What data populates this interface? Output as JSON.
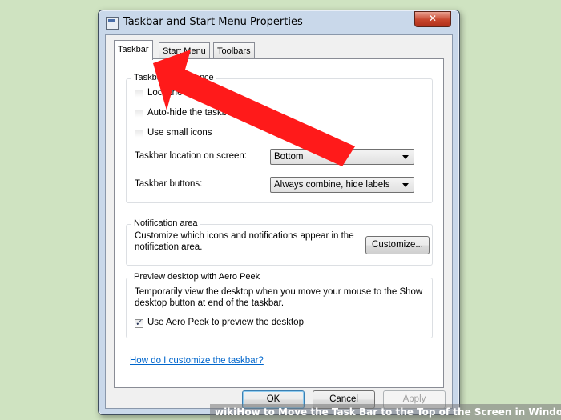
{
  "window": {
    "title": "Taskbar and Start Menu Properties",
    "close_label": "✕"
  },
  "tabs": [
    {
      "label": "Taskbar",
      "active": true
    },
    {
      "label": "Start Menu",
      "active": false
    },
    {
      "label": "Toolbars",
      "active": false
    }
  ],
  "appearance": {
    "legend": "Taskbar appearance",
    "lock_label": "Lock the taskbar",
    "lock_checked": false,
    "autohide_label": "Auto-hide the taskbar",
    "autohide_checked": false,
    "small_icons_label": "Use small icons",
    "small_icons_checked": false,
    "location_label": "Taskbar location on screen:",
    "location_value": "Bottom",
    "buttons_label": "Taskbar buttons:",
    "buttons_value": "Always combine, hide labels"
  },
  "notification": {
    "legend": "Notification area",
    "text": "Customize which icons and notifications appear in the notification area.",
    "customize_label": "Customize..."
  },
  "peek": {
    "legend": "Preview desktop with Aero Peek",
    "text": "Temporarily view the desktop when you move your mouse to the Show desktop button at end of the taskbar.",
    "checkbox_label": "Use Aero Peek to preview the desktop",
    "checked": true
  },
  "help_link": "How do I customize the taskbar?",
  "buttons": {
    "ok": "OK",
    "cancel": "Cancel",
    "apply": "Apply"
  },
  "overlay": {
    "arrow_color": "#ff1a1a",
    "watermark_text": "wikiHow to Move the Task Bar to the Top of the Screen in Windows"
  }
}
